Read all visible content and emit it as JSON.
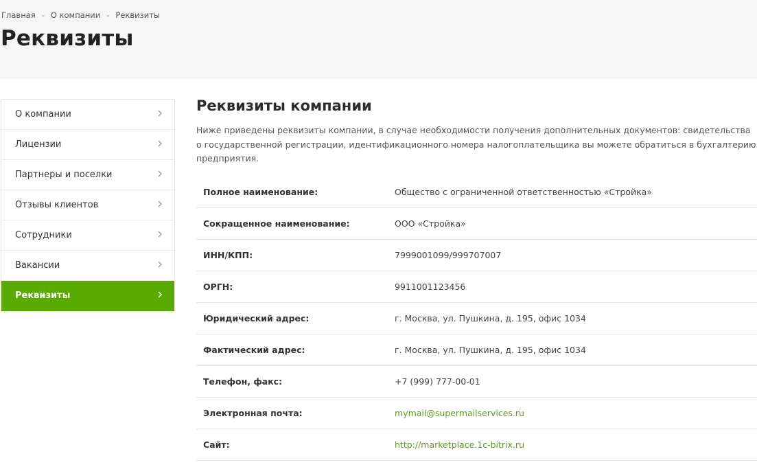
{
  "breadcrumb": {
    "items": [
      "Главная",
      "О компании",
      "Реквизиты"
    ],
    "separator": "-"
  },
  "page_title": "Реквизиты",
  "sidebar": {
    "items": [
      {
        "label": "О компании",
        "icon": "chevron-right-icon",
        "active": false
      },
      {
        "label": "Лицензии",
        "icon": "chevron-right-icon",
        "active": false
      },
      {
        "label": "Партнеры и поселки",
        "icon": "chevron-right-icon",
        "active": false
      },
      {
        "label": "Отзывы клиентов",
        "icon": "chevron-right-icon",
        "active": false
      },
      {
        "label": "Сотрудники",
        "icon": "chevron-right-icon",
        "active": false
      },
      {
        "label": "Вакансии",
        "icon": "chevron-right-icon",
        "active": false
      },
      {
        "label": "Реквизиты",
        "icon": "chevron-right-icon",
        "active": true
      }
    ]
  },
  "content": {
    "title": "Реквизиты компании",
    "intro": "Ниже приведены реквизиты компании, в случае необходимости получения дополнительных документов: свидетельства о государственной регистрации, идентификационного номера налогоплательщика вы можете обратиться в бухгалтерию предприятия.",
    "rows": [
      {
        "key": "Полное наименование:",
        "value": "Общество с ограниченной ответственностью «Стройка»"
      },
      {
        "key": "Сокращенное наименование:",
        "value": "ООО «Стройка»"
      },
      {
        "key": "ИНН/КПП:",
        "value": "7999001099/999707007"
      },
      {
        "key": "ОРГН:",
        "value": "9911001123456"
      },
      {
        "key": "Юридический адрес:",
        "value": "г. Москва, ул. Пушкина, д. 195, офис 1034"
      },
      {
        "key": "Фактический адрес:",
        "value": "г. Москва, ул. Пушкина, д. 195, офис 1034"
      },
      {
        "key": "Телефон, факс:",
        "value": "+7 (999) 777-00-01"
      },
      {
        "key": "Электронная почта:",
        "value": "mymail@supermailservices.ru"
      },
      {
        "key": "Сайт:",
        "value": "http://marketplace.1c-bitrix.ru"
      }
    ]
  },
  "colors": {
    "accent": "#5aab00",
    "link": "#5a9e1a",
    "header_band": "#f6f6f6"
  }
}
